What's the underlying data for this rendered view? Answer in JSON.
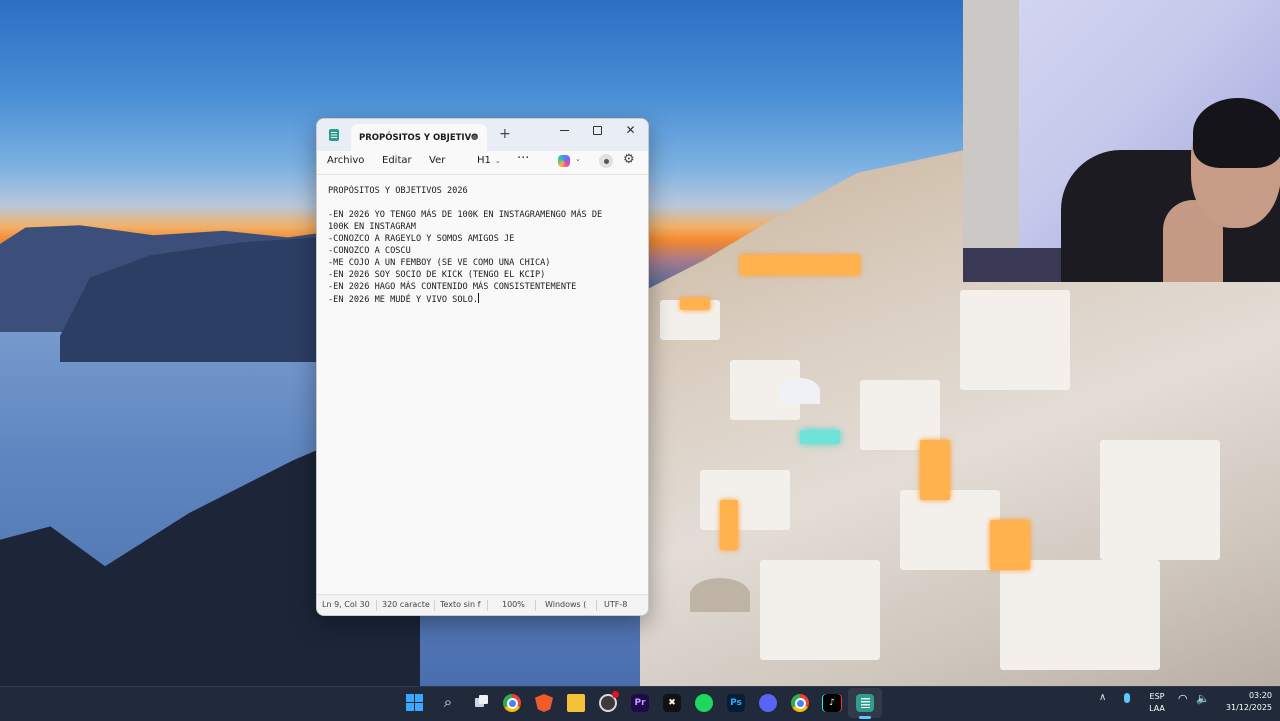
{
  "notepad": {
    "tab_title": "PROPÓSITOS Y OBJETIVO",
    "new_tab_symbol": "+",
    "window_controls": {
      "close": "✕"
    },
    "menu": {
      "archivo": "Archivo",
      "editar": "Editar",
      "ver": "Ver"
    },
    "heading": "H1",
    "more": "···",
    "settings_symbol": "⚙",
    "content_lines": [
      "PROPÓSITOS Y OBJETIVOS 2026",
      "",
      "-EN 2026 YO TENGO MÁS DE 100K EN INSTAGRAMENGO MÁS DE",
      "100K EN INSTAGRAM",
      "-CONOZCO A RAGEYLO Y SOMOS AMIGOS JE",
      "-CONOZCO A COSCU",
      "-ME COJO A UN FEMBOY (SE VE COMO UNA CHICA)",
      "-EN 2026 SOY SOCIO DE KICK (TENGO EL KCIP)",
      "-EN 2026 HAGO MÁS CONTENIDO MÁS CONSISTENTEMENTE",
      "-EN 2026 ME MUDÉ Y VIVO SOLO."
    ],
    "status": {
      "position": "Ln 9, Col 30",
      "characters": "320 caracte",
      "format": "Texto sin f",
      "zoom": "100%",
      "line_ending": "Windows (",
      "encoding": "UTF-8"
    }
  },
  "taskbar": {
    "search_symbol": "⌕",
    "apps": [
      {
        "name": "Adobe Premiere Pro",
        "glyph": "Pr"
      },
      {
        "name": "CapCut",
        "glyph": "✖"
      },
      {
        "name": "Photoshop",
        "glyph": "Ps"
      },
      {
        "name": "TikTok",
        "glyph": "♪"
      }
    ],
    "tray": {
      "chevron": "∧",
      "language": "ESP",
      "layout": "LAA",
      "wifi_symbol": "◠",
      "volume_symbol": "🔈",
      "time": "03:20",
      "date": "31/12/2025"
    }
  },
  "colors": {
    "notepad_accent": "#2f9c8e",
    "taskbar_bg": "#202a3a",
    "active_indicator": "#5cc8ff"
  }
}
